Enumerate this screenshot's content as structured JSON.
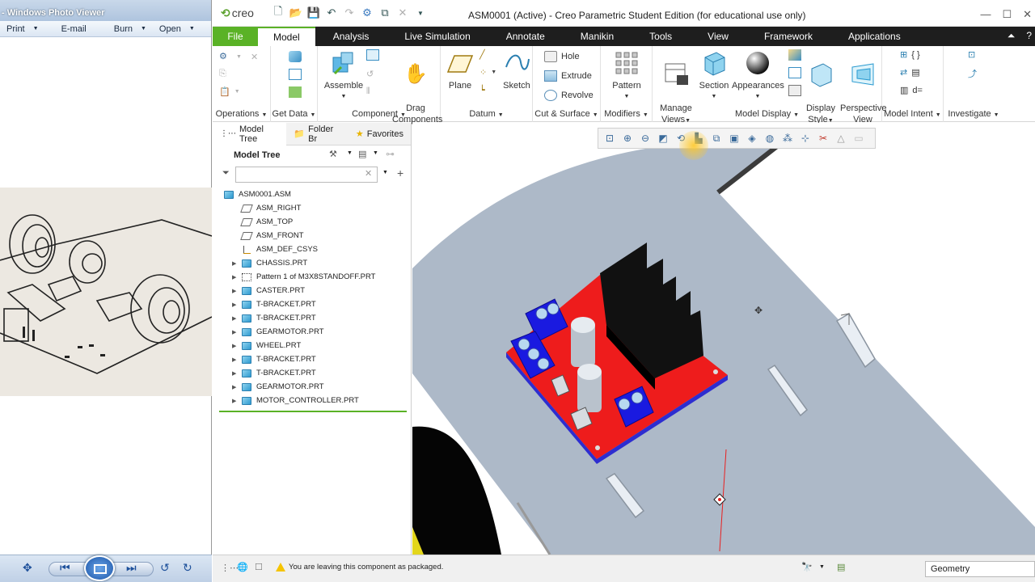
{
  "photo_viewer": {
    "title": "- Windows Photo Viewer",
    "menu": [
      "Print",
      "E-mail",
      "Burn",
      "Open"
    ]
  },
  "creo": {
    "logo": "creo",
    "window_title": "ASM0001 (Active) - Creo Parametric Student Edition (for educational use only)",
    "tabs": [
      "File",
      "Model",
      "Analysis",
      "Live Simulation",
      "Annotate",
      "Manikin",
      "Tools",
      "View",
      "Framework",
      "Applications"
    ],
    "active_tab": "Model",
    "ribbon": {
      "operations_label": "Operations",
      "get_data_label": "Get Data",
      "component_label": "Component",
      "assemble_label": "Assemble",
      "drag_components_label": "Drag\nComponents",
      "datum_label": "Datum",
      "plane_label": "Plane",
      "sketch_label": "Sketch",
      "cut_surface_label": "Cut & Surface",
      "hole_label": "Hole",
      "extrude_label": "Extrude",
      "revolve_label": "Revolve",
      "modifiers_label": "Modifiers",
      "pattern_label": "Pattern",
      "model_display_label": "Model Display",
      "manage_views_label": "Manage\nViews",
      "section_label": "Section",
      "appearances_label": "Appearances",
      "display_style_label": "Display\nStyle",
      "perspective_view_label": "Perspective\nView",
      "model_intent_label": "Model Intent",
      "investigate_label": "Investigate"
    },
    "tree_panel": {
      "tabs": [
        "Model Tree",
        "Folder Br",
        "Favorites"
      ],
      "header": "Model Tree",
      "search_value": "",
      "items": [
        {
          "label": "ASM0001.ASM",
          "icon": "assembly-icon",
          "expand": false,
          "indent": 0
        },
        {
          "label": "ASM_RIGHT",
          "icon": "datum-plane-icon",
          "expand": false,
          "indent": 1
        },
        {
          "label": "ASM_TOP",
          "icon": "datum-plane-icon",
          "expand": false,
          "indent": 1
        },
        {
          "label": "ASM_FRONT",
          "icon": "datum-plane-icon",
          "expand": false,
          "indent": 1
        },
        {
          "label": "ASM_DEF_CSYS",
          "icon": "csys-icon",
          "expand": false,
          "indent": 1
        },
        {
          "label": "CHASSIS.PRT",
          "icon": "part-icon",
          "expand": true,
          "indent": 1
        },
        {
          "label": "Pattern 1 of M3X8STANDOFF.PRT",
          "icon": "pattern-icon",
          "expand": true,
          "indent": 1
        },
        {
          "label": "CASTER.PRT",
          "icon": "part-icon",
          "expand": true,
          "indent": 1
        },
        {
          "label": "T-BRACKET.PRT",
          "icon": "part-icon",
          "expand": true,
          "indent": 1
        },
        {
          "label": "T-BRACKET.PRT",
          "icon": "part-icon",
          "expand": true,
          "indent": 1
        },
        {
          "label": "GEARMOTOR.PRT",
          "icon": "part-icon",
          "expand": true,
          "indent": 1
        },
        {
          "label": "WHEEL.PRT",
          "icon": "part-icon",
          "expand": true,
          "indent": 1
        },
        {
          "label": "T-BRACKET.PRT",
          "icon": "part-icon",
          "expand": true,
          "indent": 1
        },
        {
          "label": "T-BRACKET.PRT",
          "icon": "part-icon",
          "expand": true,
          "indent": 1
        },
        {
          "label": "GEARMOTOR.PRT",
          "icon": "part-icon",
          "expand": true,
          "indent": 1
        },
        {
          "label": "MOTOR_CONTROLLER.PRT",
          "icon": "part-icon",
          "expand": true,
          "indent": 1
        }
      ]
    },
    "status": {
      "message": "You are leaving this component as packaged.",
      "filter_value": "Geometry"
    },
    "colors": {
      "file_tab": "#5ab226",
      "tab_bar": "#1e1e1e",
      "model_bg": "#adb9c8",
      "pcb_red": "#ee1c1c",
      "terminal_blue": "#1a1ae0",
      "heatsink": "#111111"
    }
  }
}
